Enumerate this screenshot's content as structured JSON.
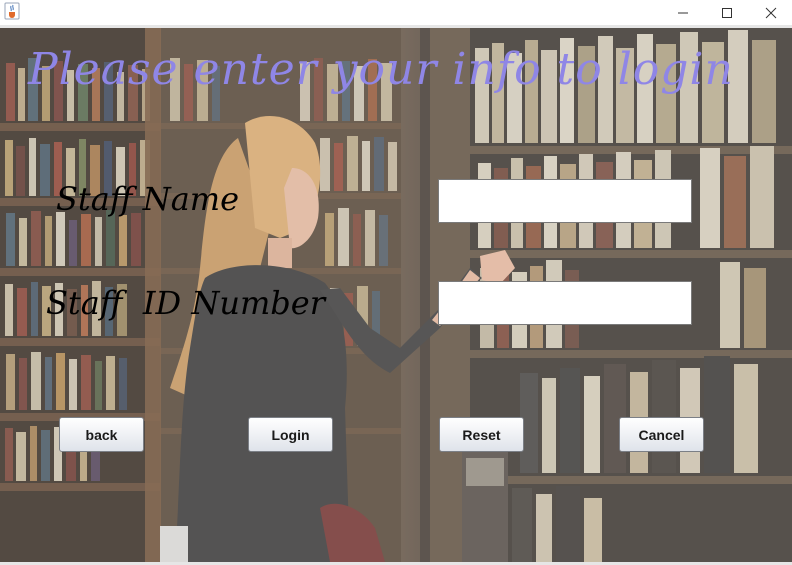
{
  "window": {
    "app_icon": "java-cup-icon",
    "controls": [
      "minimize-icon",
      "maximize-icon",
      "close-icon"
    ]
  },
  "form": {
    "heading": "Please enter your info to login",
    "staff_name_label": "Staff Name",
    "staff_name_value": "",
    "staff_id_label": "Staff  ID Number",
    "staff_id_value": ""
  },
  "buttons": {
    "back": "back",
    "login": "Login",
    "reset": "Reset",
    "cancel": "Cancel"
  },
  "colors": {
    "heading": "#8f86e6",
    "labels": "#000000",
    "field_bg": "#ffffff"
  },
  "background_image": "library-bookshelves-woman-photo"
}
